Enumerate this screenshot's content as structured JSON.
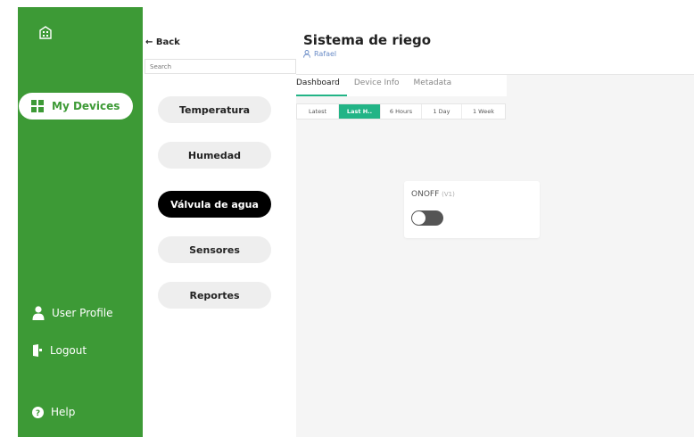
{
  "sidebar": {
    "logo_icon": "building-logo-icon",
    "items": [
      {
        "label": "My Devices",
        "icon": "grid-icon",
        "active": true
      },
      {
        "label": "User Profile",
        "icon": "user-icon"
      },
      {
        "label": "Logout",
        "icon": "door-exit-icon"
      },
      {
        "label": "Help",
        "icon": "question-icon"
      }
    ],
    "accent_color": "#3d9a36"
  },
  "menu": {
    "back_label": "← Back",
    "search_placeholder": "Search",
    "items": [
      {
        "label": "Temperatura"
      },
      {
        "label": "Humedad"
      },
      {
        "label": "Válvula de agua",
        "active": true
      },
      {
        "label": "Sensores"
      },
      {
        "label": "Reportes"
      }
    ]
  },
  "device": {
    "title": "Sistema de riego",
    "owner": "Rafael"
  },
  "tabs": [
    {
      "label": "Dashboard",
      "active": true
    },
    {
      "label": "Device Info"
    },
    {
      "label": "Metadata"
    }
  ],
  "time_ranges": [
    {
      "label": "Latest"
    },
    {
      "label": "Last H..",
      "active": true
    },
    {
      "label": "6 Hours"
    },
    {
      "label": "1 Day"
    },
    {
      "label": "1 Week"
    }
  ],
  "widget": {
    "name": "ONOFF",
    "pin": "(V1)",
    "state": "off"
  },
  "colors": {
    "active_tab_accent": "#22b486",
    "active_menu": "#000000"
  }
}
